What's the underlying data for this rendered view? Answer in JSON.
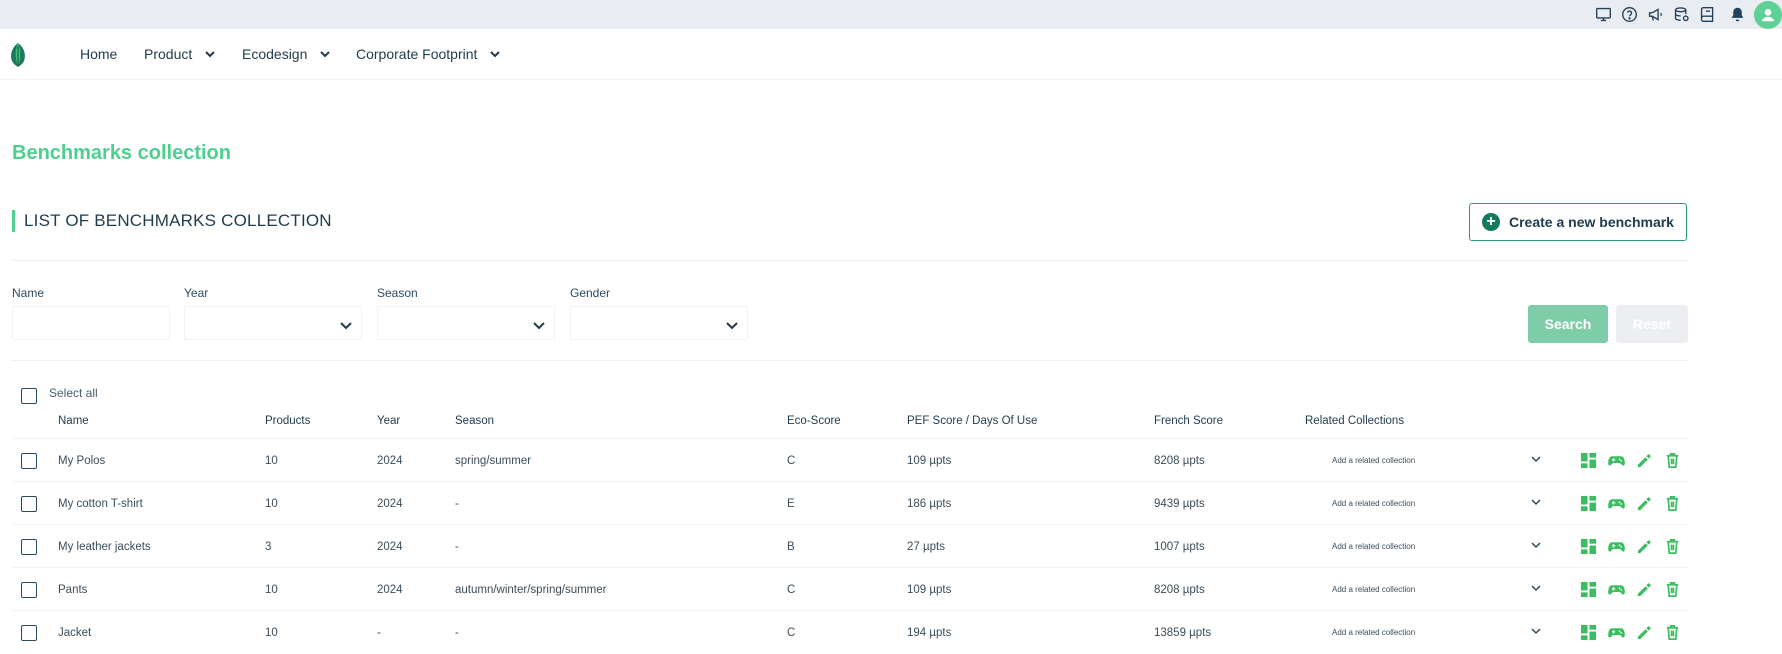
{
  "nav": {
    "items": [
      {
        "label": "Home",
        "has_dropdown": false
      },
      {
        "label": "Product",
        "has_dropdown": true
      },
      {
        "label": "Ecodesign",
        "has_dropdown": true
      },
      {
        "label": "Corporate Footprint",
        "has_dropdown": true
      }
    ]
  },
  "topbar": {
    "icons": [
      "monitor-icon",
      "help-icon",
      "megaphone-icon",
      "database-icon",
      "book-icon",
      "bell-icon",
      "user-avatar-icon"
    ]
  },
  "page": {
    "title": "Benchmarks collection",
    "section_title": "LIST OF BENCHMARKS COLLECTION",
    "create_button": "Create a new benchmark"
  },
  "filters": {
    "name_label": "Name",
    "year_label": "Year",
    "season_label": "Season",
    "gender_label": "Gender",
    "search_button": "Search",
    "reset_button": "Reset"
  },
  "table": {
    "select_all": "Select all",
    "headers": {
      "name": "Name",
      "products": "Products",
      "year": "Year",
      "season": "Season",
      "eco_score": "Eco-Score",
      "pef": "PEF Score / Days Of Use",
      "french": "French Score",
      "related": "Related Collections"
    },
    "rows": [
      {
        "name": "My Polos",
        "products": "10",
        "year": "2024",
        "season": "spring/summer",
        "eco_score": "C",
        "pef": "109 µpts",
        "french": "8208 µpts",
        "related": "Add a related collection"
      },
      {
        "name": "My cotton T-shirt",
        "products": "10",
        "year": "2024",
        "season": "-",
        "eco_score": "E",
        "pef": "186 µpts",
        "french": "9439 µpts",
        "related": "Add a related collection"
      },
      {
        "name": "My leather jackets",
        "products": "3",
        "year": "2024",
        "season": "-",
        "eco_score": "B",
        "pef": "27 µpts",
        "french": "1007 µpts",
        "related": "Add a related collection"
      },
      {
        "name": "Pants",
        "products": "10",
        "year": "2024",
        "season": "autumn/winter/spring/summer",
        "eco_score": "C",
        "pef": "109 µpts",
        "french": "8208 µpts",
        "related": "Add a related collection"
      },
      {
        "name": "Jacket",
        "products": "10",
        "year": "-",
        "season": "-",
        "eco_score": "C",
        "pef": "194 µpts",
        "french": "13859 µpts",
        "related": "Add a related collection"
      }
    ]
  },
  "colors": {
    "brand_green": "#4fcf8f",
    "action_green": "#3dbd62",
    "dark_text": "#1f3b4d"
  }
}
